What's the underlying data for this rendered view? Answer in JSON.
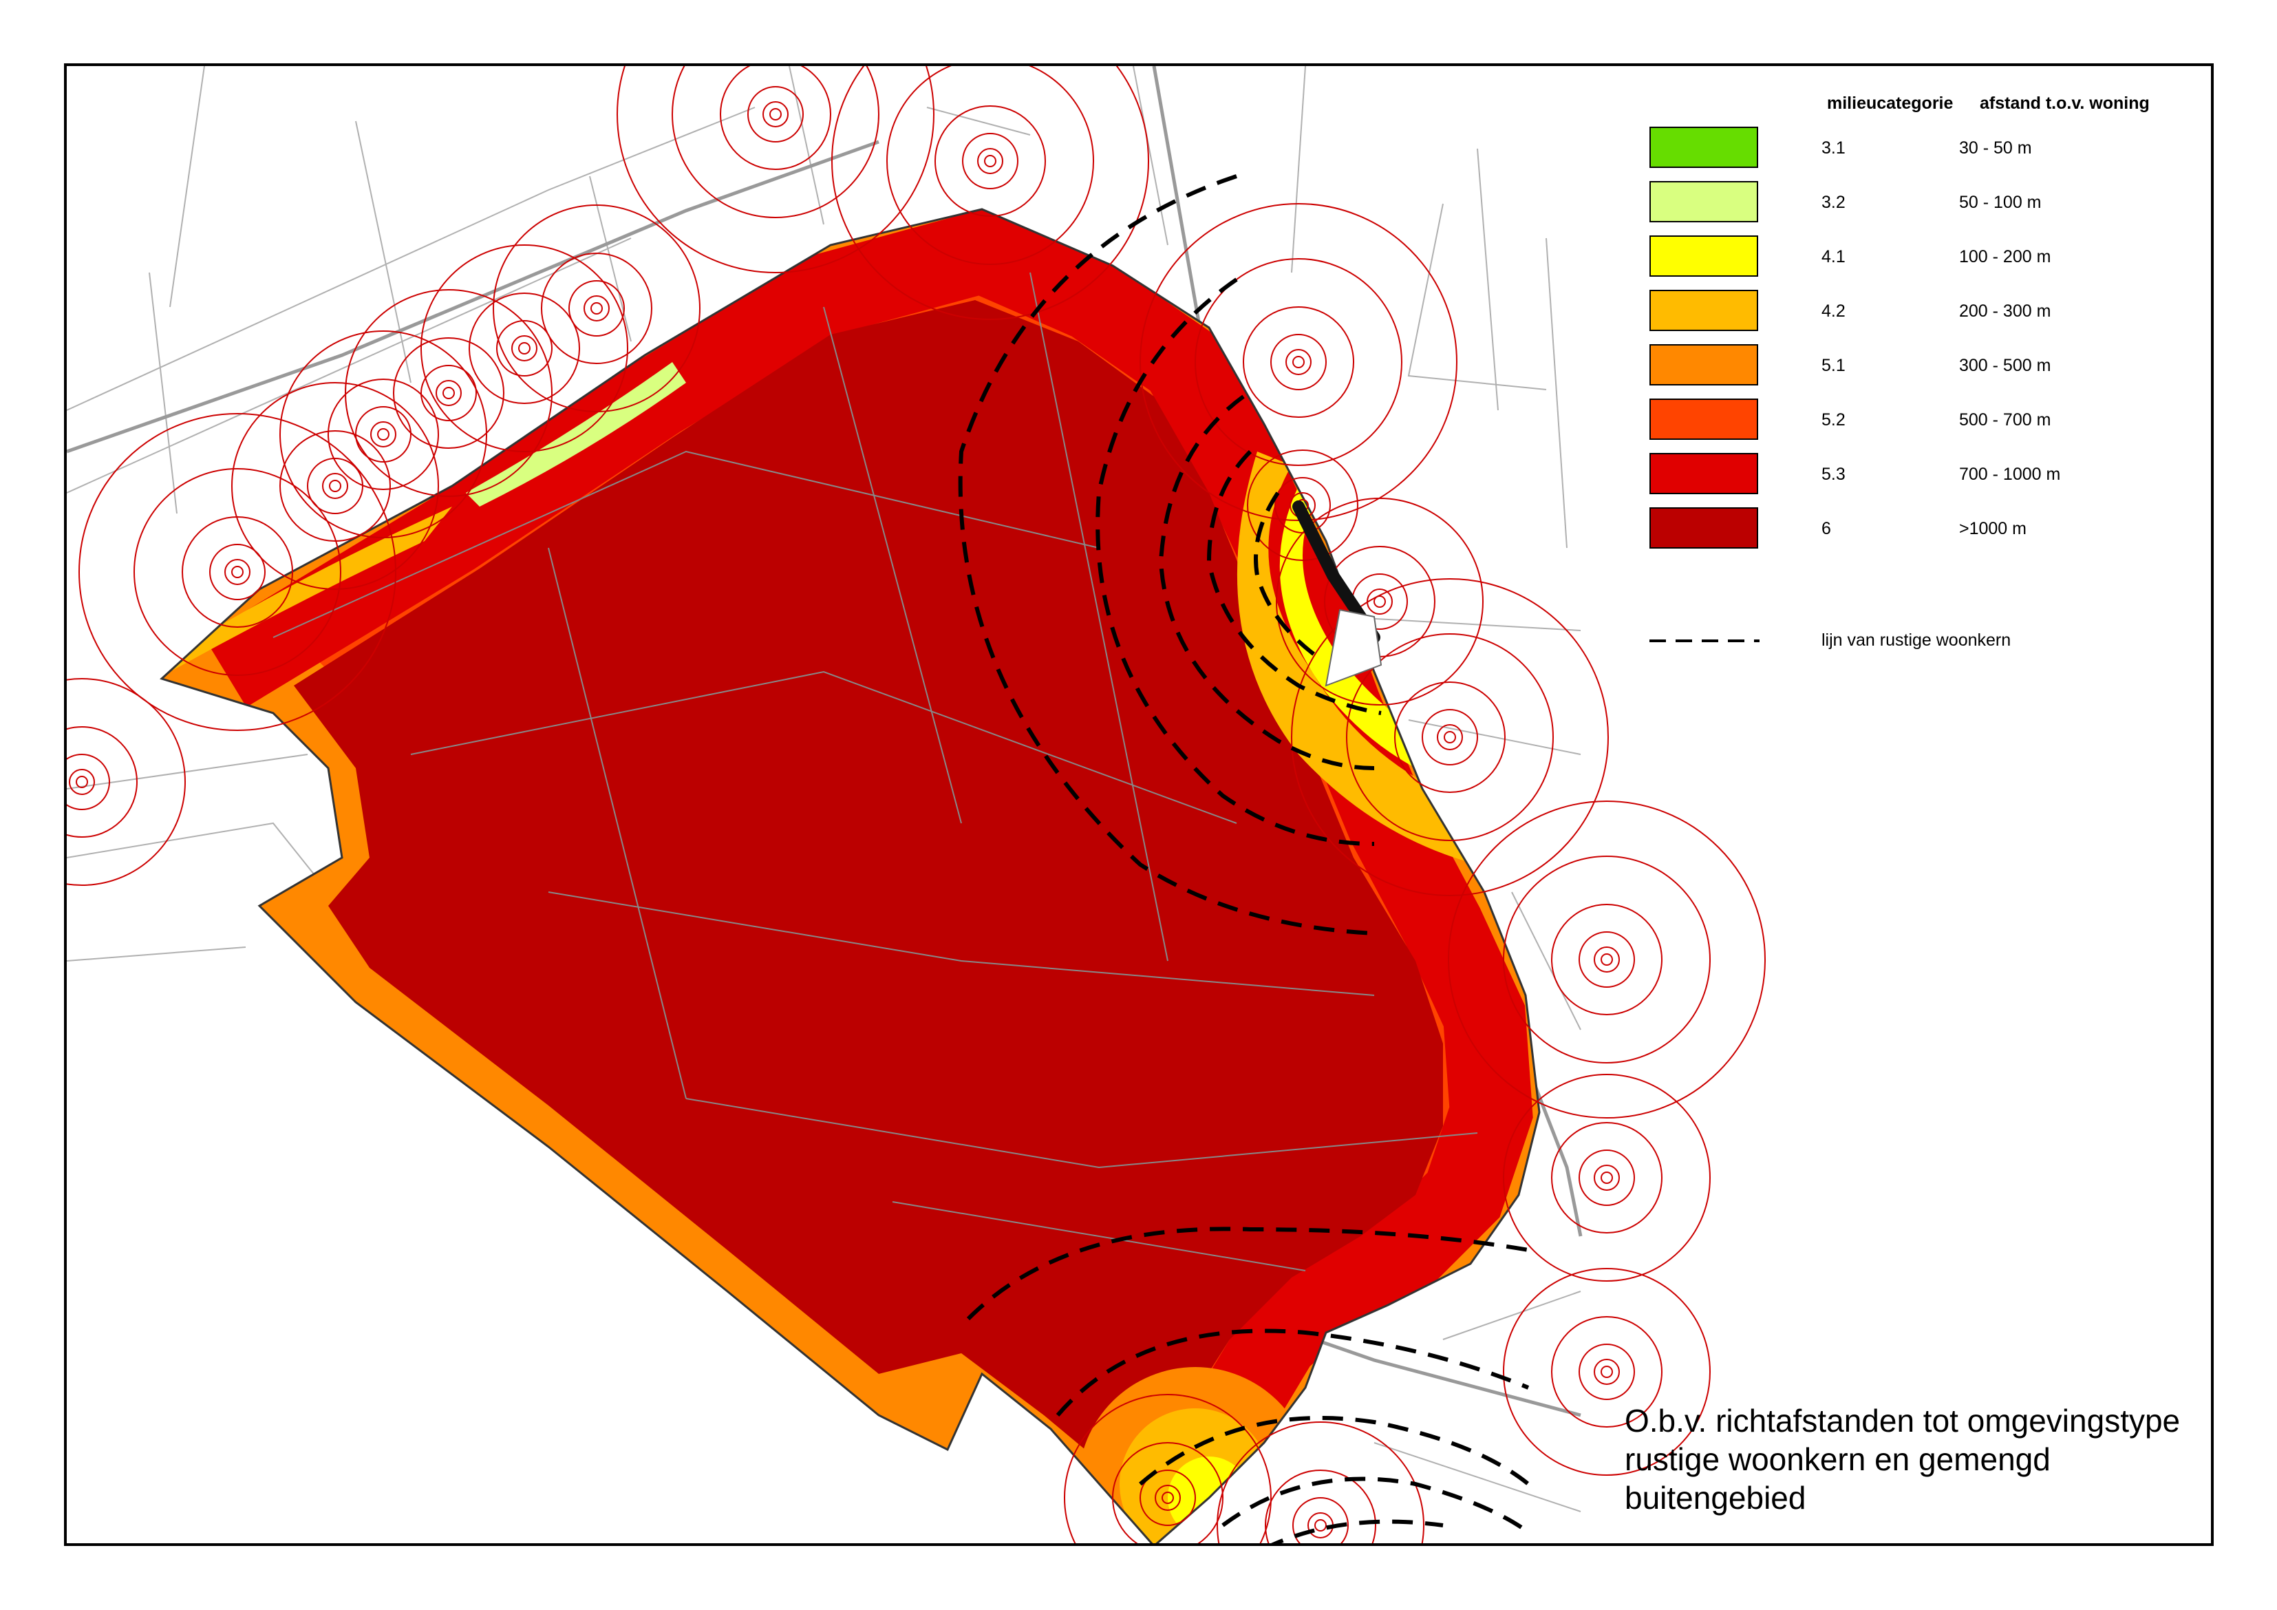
{
  "legend": {
    "header_category": "milieucategorie",
    "header_distance": "afstand t.o.v. woning",
    "items": [
      {
        "category": "3.1",
        "distance": "30 - 50 m",
        "color": "#66dd00"
      },
      {
        "category": "3.2",
        "distance": "50 - 100 m",
        "color": "#d9ff80"
      },
      {
        "category": "4.1",
        "distance": "100 - 200 m",
        "color": "#ffff00"
      },
      {
        "category": "4.2",
        "distance": "200 - 300 m",
        "color": "#ffbb00"
      },
      {
        "category": "5.1",
        "distance": "300 - 500 m",
        "color": "#ff8800"
      },
      {
        "category": "5.2",
        "distance": "500 - 700 m",
        "color": "#ff4400"
      },
      {
        "category": "5.3",
        "distance": "700 - 1000 m",
        "color": "#e00000"
      },
      {
        "category": "6",
        "distance": ">1000 m",
        "color": "#bb0000"
      }
    ],
    "line_label": "lijn van rustige woonkern",
    "line_style": "dashed-black"
  },
  "note": {
    "line1": "O.b.v. richtafstanden tot omgevingstype",
    "line2": "rustige woonkern en gemengd buitengebied"
  },
  "map": {
    "colors": {
      "zone_outer": "#bb0000",
      "ring_color": "#cc0000",
      "road_color": "#999999",
      "base_line_color": "#b0b0b0",
      "woonkern_line": "#000000"
    }
  }
}
